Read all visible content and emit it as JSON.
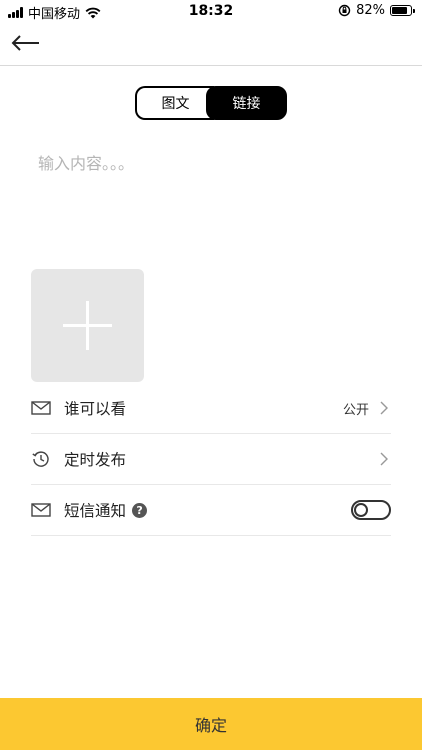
{
  "status_bar": {
    "carrier": "中国移动",
    "time": "18:32",
    "battery_percent": "82%",
    "battery_level": 0.82,
    "icons": [
      "signal-icon",
      "wifi-icon",
      "orientation-lock-icon",
      "battery-icon"
    ]
  },
  "nav": {
    "back_icon": "back-arrow-icon"
  },
  "segment": {
    "tabs": [
      {
        "label": "图文",
        "selected": false
      },
      {
        "label": "链接",
        "selected": true
      }
    ]
  },
  "editor": {
    "placeholder": "输入内容。。。",
    "value": ""
  },
  "image_upload": {
    "icon": "plus-icon"
  },
  "settings": {
    "who_can_see": {
      "label": "谁可以看",
      "value": "公开",
      "icon": "mail-icon"
    },
    "scheduled": {
      "label": "定时发布",
      "icon": "history-icon"
    },
    "sms": {
      "label": "短信通知",
      "help": "?",
      "icon": "mail-icon",
      "enabled": false
    }
  },
  "footer": {
    "confirm_label": "确定"
  },
  "colors": {
    "accent": "#fcc831",
    "segment_active": "#000000",
    "divider": "#e8e8e8"
  }
}
